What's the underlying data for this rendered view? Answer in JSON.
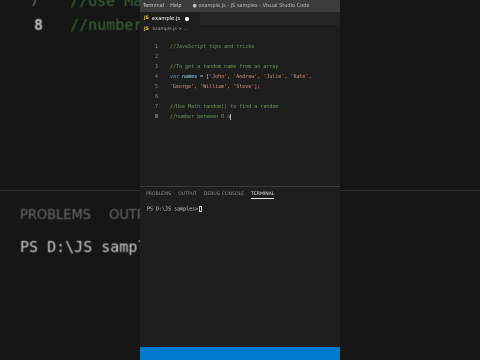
{
  "background": {
    "left_lines": [
      {
        "num": "7",
        "text": "//Use Math",
        "active": false
      },
      {
        "num": "8",
        "text": "//number",
        "active": true
      }
    ],
    "panel_tabs": [
      "PROBLEMS",
      "OUTPU"
    ],
    "terminal_prompt": "PS D:\\JS samples"
  },
  "window": {
    "menu": [
      "Terminal",
      "Help"
    ],
    "title": "● example.js - JS samples - Visual Studio Code"
  },
  "tab": {
    "icon": "JS",
    "label": "example.js"
  },
  "breadcrumb": {
    "icon": "JS",
    "text": "example.js > ..."
  },
  "editor": {
    "lines": [
      {
        "num": "1",
        "text": "//JavaScript tips and tricks"
      },
      {
        "num": "2",
        "text": ""
      },
      {
        "num": "3",
        "text": "//To get a random name from an array"
      },
      {
        "num": "4",
        "kw": "var",
        "name": "names",
        "eq": " = [",
        "items": "'John', 'Andrew', 'Julie', 'Kate',"
      },
      {
        "num": "5",
        "items": "'George', 'William', 'Steve'];"
      },
      {
        "num": "6",
        "text": ""
      },
      {
        "num": "7",
        "text": "//Use Math.random() to find a random"
      },
      {
        "num": "8",
        "text": "//number between 0 a"
      }
    ]
  },
  "panel": {
    "tabs": [
      "PROBLEMS",
      "OUTPUT",
      "DEBUG CONSOLE",
      "TERMINAL"
    ],
    "active_tab": "TERMINAL",
    "terminal_prompt": "PS D:\\JS samples>"
  },
  "colors": {
    "editor_bg": "#1e1e1e",
    "statusbar": "#007acc",
    "comment": "#6a9955",
    "keyword": "#569cd6",
    "string": "#ce9178"
  }
}
